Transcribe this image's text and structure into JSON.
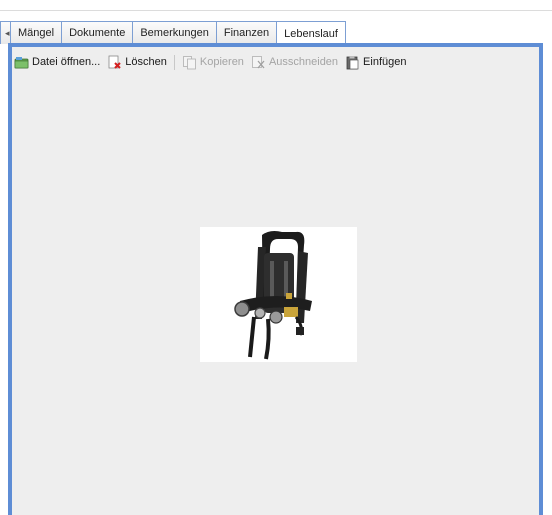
{
  "tabs": [
    {
      "label": ""
    },
    {
      "label": "Mängel"
    },
    {
      "label": "Dokumente"
    },
    {
      "label": "Bemerkungen"
    },
    {
      "label": "Finanzen"
    },
    {
      "label": "Lebenslauf"
    }
  ],
  "toolbar": {
    "open_label": "Datei öffnen...",
    "delete_label": "Löschen",
    "copy_label": "Kopieren",
    "cut_label": "Ausschneiden",
    "paste_label": "Einfügen"
  },
  "colors": {
    "tab_border": "#7d9fd3",
    "panel_border": "#5e8dd5",
    "panel_bg": "#eeeeee",
    "disabled_text": "#a4a4a4"
  },
  "icons": {
    "open": "open-folder-icon",
    "delete": "delete-document-icon",
    "copy": "copy-icon",
    "cut": "cut-icon",
    "paste": "paste-icon"
  },
  "image": {
    "subject": "breathing apparatus harness photo"
  }
}
